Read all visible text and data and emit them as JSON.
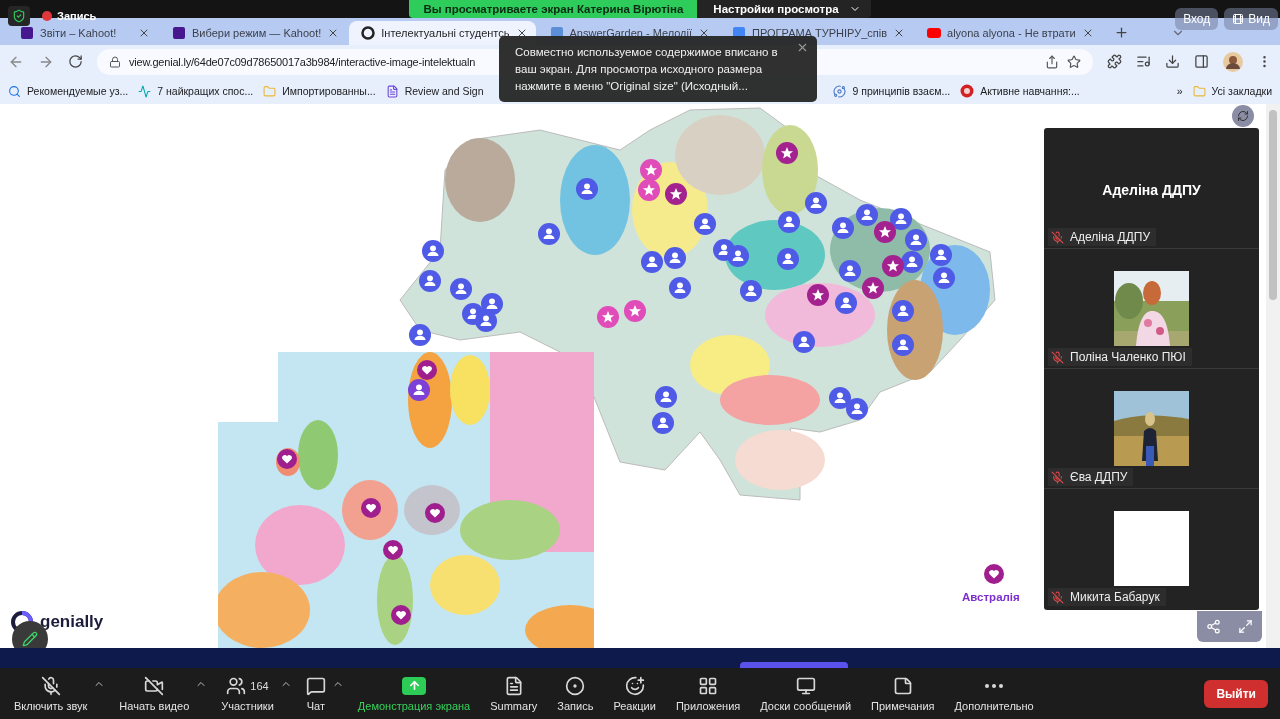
{
  "zoom_banner": {
    "viewing": "Вы просматриваете экран Катерина Вірютіна",
    "options": "Настройки просмотра"
  },
  "recording": {
    "label": "Запись"
  },
  "browser": {
    "tabs": [
      {
        "title": "Звіти – Kahoot!",
        "kind": "kahoot",
        "selected": false
      },
      {
        "title": "Вибери режим — Kahoot!",
        "kind": "kahoot",
        "selected": false
      },
      {
        "title": "Інтелектуальні студентсь",
        "kind": "genially",
        "selected": true
      },
      {
        "title": "AnswerGarden - Мелодії",
        "kind": "answergarden",
        "selected": false
      },
      {
        "title": "ПРОГРАМА ТУРНІРУ_спів",
        "kind": "docs",
        "selected": false
      },
      {
        "title": "alyona alyona - Не втрати",
        "kind": "youtube",
        "selected": false
      }
    ],
    "address": "view.genial.ly/64de07c09d78650017a3b984/interactive-image-intelektualn",
    "bookmarks_left": [
      {
        "label": "Рекомендуемые уз...",
        "kind": "search"
      },
      {
        "label": "7 найкращих спос...",
        "kind": "pulse"
      },
      {
        "label": "Импортированны...",
        "kind": "folder"
      },
      {
        "label": "Review and Sign",
        "kind": "pdf"
      }
    ],
    "bookmarks_right": [
      {
        "label": "9 принципів взаєм...",
        "kind": "spiral"
      },
      {
        "label": "Активне навчання:...",
        "kind": "red"
      }
    ],
    "more": "»",
    "all_bookmarks": "Усі закладки"
  },
  "notice": "Совместно используемое содержимое вписано в ваш экран. Для просмотра исходного размера нажмите в меню \"Original size\" (Исходный...",
  "overlay_buttons": [
    {
      "label": "Вход",
      "kind": "plain"
    },
    {
      "label": "Вид",
      "kind": "grid"
    }
  ],
  "slide": {
    "logo": "genially",
    "pin_label": "Австралія"
  },
  "participants": [
    {
      "kind": "name_only",
      "display": "Аделіна ДДПУ",
      "name": "Аделіна ДДПУ",
      "muted": true
    },
    {
      "kind": "field_photo",
      "name": "Поліна Чаленко ПЮІ",
      "muted": true
    },
    {
      "kind": "steppe_photo",
      "name": "Єва ДДПУ",
      "muted": true
    },
    {
      "kind": "blank",
      "name": "Микита Бабарук",
      "muted": true
    }
  ],
  "toolbar": {
    "items": [
      {
        "label": "Включить звук",
        "kind": "mic",
        "caret": true
      },
      {
        "label": "Начать видео",
        "kind": "video",
        "caret": true
      },
      {
        "label": "Участники",
        "kind": "participants",
        "count": "164",
        "caret": true
      },
      {
        "label": "Чат",
        "kind": "chat",
        "caret": true
      },
      {
        "label": "Демонстрация экрана",
        "kind": "share",
        "caret": false
      },
      {
        "label": "Summary",
        "kind": "summary",
        "caret": false
      },
      {
        "label": "Запись",
        "kind": "record",
        "caret": false
      },
      {
        "label": "Реакции",
        "kind": "reactions",
        "caret": false
      },
      {
        "label": "Приложения",
        "kind": "apps",
        "caret": false
      },
      {
        "label": "Доски сообщений",
        "kind": "boards",
        "caret": false
      },
      {
        "label": "Примечания",
        "kind": "notes",
        "caret": false
      },
      {
        "label": "Дополнительно",
        "kind": "more",
        "caret": false
      }
    ],
    "leave": "Выйти"
  }
}
